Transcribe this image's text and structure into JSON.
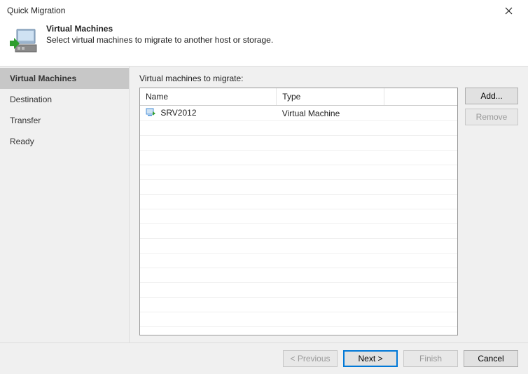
{
  "window": {
    "title": "Quick Migration"
  },
  "header": {
    "title": "Virtual Machines",
    "subtitle": "Select virtual machines to migrate to another host or storage."
  },
  "sidebar": {
    "items": [
      {
        "label": "Virtual Machines",
        "selected": true
      },
      {
        "label": "Destination",
        "selected": false
      },
      {
        "label": "Transfer",
        "selected": false
      },
      {
        "label": "Ready",
        "selected": false
      }
    ]
  },
  "main": {
    "label": "Virtual machines to migrate:",
    "table": {
      "columns": [
        "Name",
        "Type"
      ],
      "rows": [
        {
          "icon": "vm-icon",
          "name": "SRV2012",
          "type": "Virtual Machine"
        }
      ]
    },
    "buttons": {
      "add": "Add...",
      "remove": "Remove",
      "remove_enabled": false
    }
  },
  "footer": {
    "previous": "< Previous",
    "previous_enabled": false,
    "next": "Next >",
    "finish": "Finish",
    "finish_enabled": false,
    "cancel": "Cancel"
  }
}
